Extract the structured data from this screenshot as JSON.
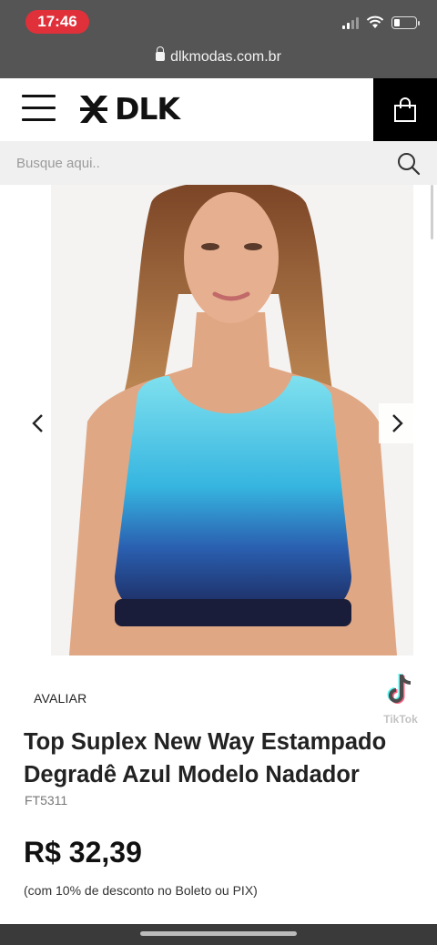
{
  "status_bar": {
    "time": "17:46",
    "battery_level": 0.3
  },
  "browser": {
    "url": "dlkmodas.com.br"
  },
  "header": {
    "logo_text": "DLK",
    "menu_icon": "hamburger-menu-icon",
    "cart_icon": "shopping-bag-icon"
  },
  "search": {
    "placeholder": "Busque aqui.."
  },
  "gallery": {
    "prev_icon": "chevron-left-icon",
    "next_icon": "chevron-right-icon",
    "top_color": "#5fd3e6",
    "bottom_color": "#1a2a6a"
  },
  "product": {
    "rate_label": "AVALIAR",
    "title": "Top Suplex New Way Estampado Degradê Azul Modelo Nadador",
    "sku": "FT5311",
    "price": "R$ 32,39",
    "discount_note": "(com 10% de desconto no Boleto ou PIX)"
  },
  "watermark": {
    "brand": "TikTok"
  }
}
